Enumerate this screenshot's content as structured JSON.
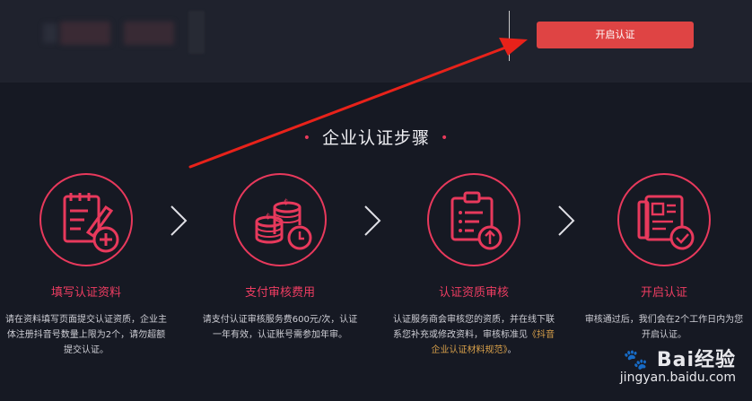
{
  "header": {
    "cta_label": "开启认证"
  },
  "section": {
    "title": "企业认证步骤"
  },
  "steps": [
    {
      "icon": "form-edit-icon",
      "title": "填写认证资料",
      "desc": "请在资料填写页面提交认证资质，企业主体注册抖音号数量上限为2个，请勿超额提交认证。"
    },
    {
      "icon": "coins-clock-icon",
      "title": "支付审核费用",
      "desc": "请支付认证审核服务费600元/次，认证一年有效，认证账号需参加年审。"
    },
    {
      "icon": "clipboard-upload-icon",
      "title": "认证资质审核",
      "desc_prefix": "认证服务商会审核您的资质，并在线下联系您补充或修改资料，审核标准见",
      "desc_link": "《抖音企业认证材料规范》",
      "desc_suffix": "。"
    },
    {
      "icon": "newspaper-check-icon",
      "title": "开启认证",
      "desc": "审核通过后，我们会在2个工作日内为您开启认证。"
    }
  ],
  "watermark": {
    "brand": "Bai经验",
    "url": "jingyan.baidu.com"
  },
  "colors": {
    "accent": "#e8395c",
    "cta": "#df4444",
    "background": "#161923",
    "header": "#1f222d"
  }
}
